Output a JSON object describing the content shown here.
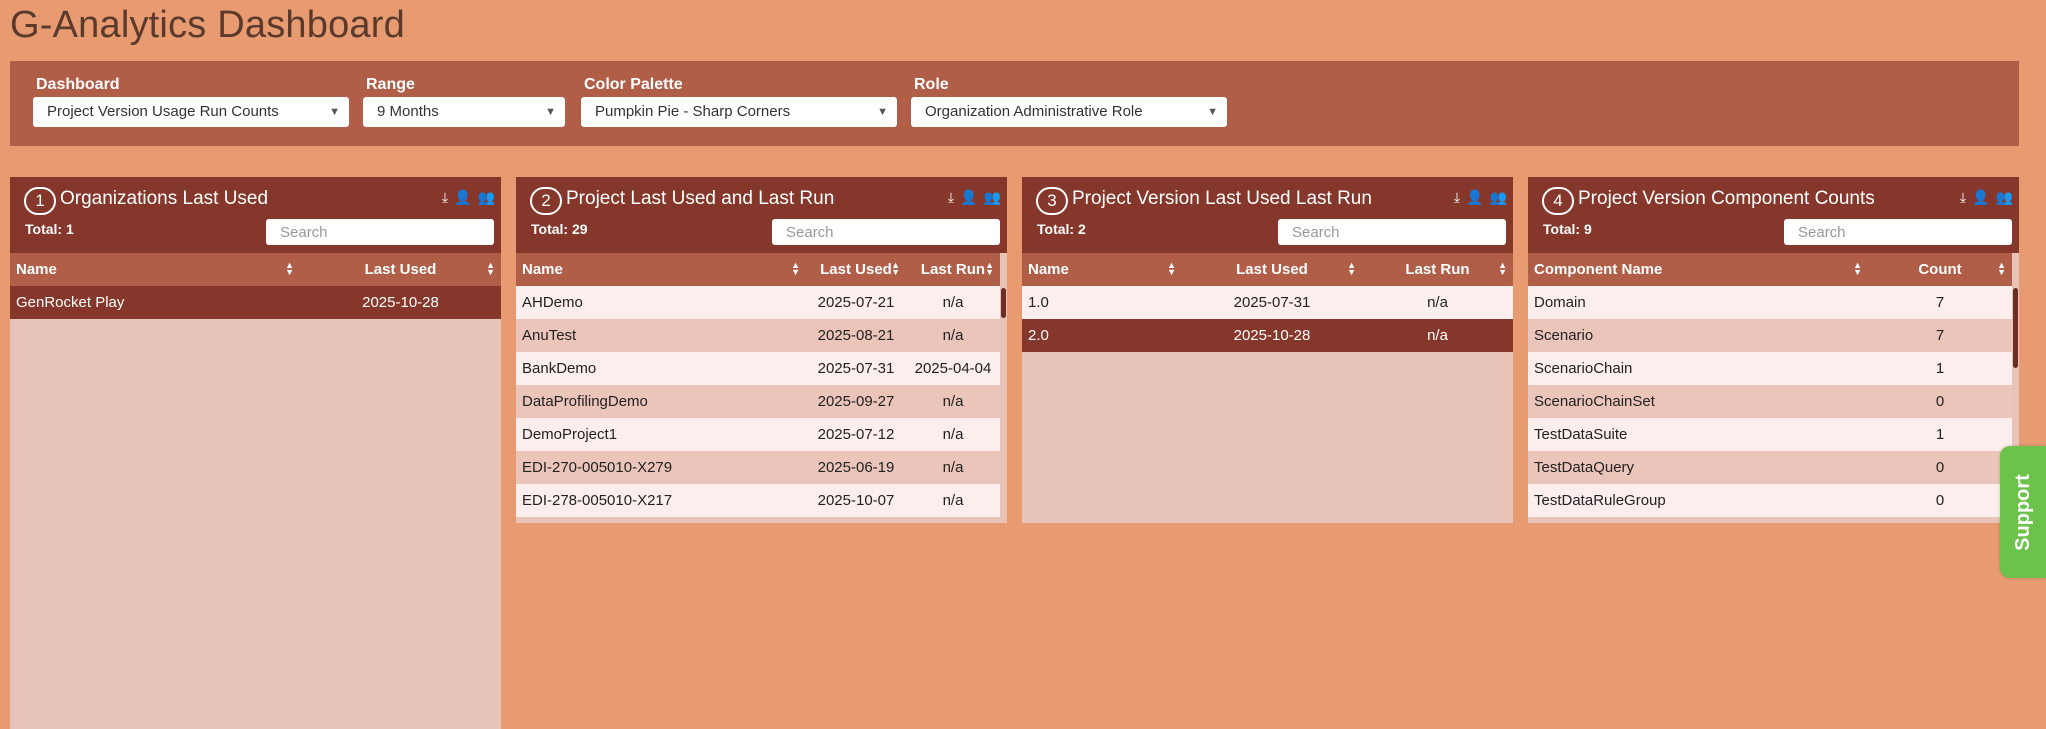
{
  "app": {
    "title": "G-Analytics Dashboard"
  },
  "filters": [
    {
      "label": "Dashboard",
      "value": "Project Version Usage Run Counts"
    },
    {
      "label": "Range",
      "value": "9 Months"
    },
    {
      "label": "Color Palette",
      "value": "Pumpkin Pie - Sharp Corners"
    },
    {
      "label": "Role",
      "value": "Organization Administrative Role"
    }
  ],
  "panels": [
    {
      "number": "1",
      "title": "Organizations Last Used",
      "total": "Total: 1",
      "search_placeholder": "Search",
      "columns": [
        "Name",
        "Last Used"
      ],
      "rows": [
        [
          "GenRocket Play",
          "2025-10-28"
        ]
      ]
    },
    {
      "number": "2",
      "title": "Project Last Used and Last Run",
      "total": "Total: 29",
      "search_placeholder": "Search",
      "columns": [
        "Name",
        "Last Used",
        "Last Run"
      ],
      "rows": [
        [
          "AHDemo",
          "2025-07-21",
          "n/a"
        ],
        [
          "AnuTest",
          "2025-08-21",
          "n/a"
        ],
        [
          "BankDemo",
          "2025-07-31",
          "2025-04-04"
        ],
        [
          "DataProfilingDemo",
          "2025-09-27",
          "n/a"
        ],
        [
          "DemoProject1",
          "2025-07-12",
          "n/a"
        ],
        [
          "EDI-270-005010-X279",
          "2025-06-19",
          "n/a"
        ],
        [
          "EDI-278-005010-X217",
          "2025-10-07",
          "n/a"
        ]
      ]
    },
    {
      "number": "3",
      "title": "Project Version Last Used Last Run",
      "total": "Total: 2",
      "search_placeholder": "Search",
      "columns": [
        "Name",
        "Last Used",
        "Last Run"
      ],
      "rows": [
        [
          "1.0",
          "2025-07-31",
          "n/a"
        ],
        [
          "2.0",
          "2025-10-28",
          "n/a"
        ]
      ]
    },
    {
      "number": "4",
      "title": "Project Version Component Counts",
      "total": "Total: 9",
      "search_placeholder": "Search",
      "columns": [
        "Component Name",
        "Count"
      ],
      "rows": [
        [
          "Domain",
          "7"
        ],
        [
          "Scenario",
          "7"
        ],
        [
          "ScenarioChain",
          "1"
        ],
        [
          "ScenarioChainSet",
          "0"
        ],
        [
          "TestDataSuite",
          "1"
        ],
        [
          "TestDataQuery",
          "0"
        ],
        [
          "TestDataRuleGroup",
          "0"
        ]
      ]
    }
  ],
  "support": {
    "label": "Support"
  },
  "icons": {
    "download": "download-icon",
    "user": "user-icon",
    "users": "users-icon",
    "sort": "sort-icon",
    "dropdown": "chevron-down-icon"
  },
  "colors": {
    "background": "#e89a70",
    "panel_header": "#86372b",
    "filter_bar": "#b05e48",
    "row_light": "#fbeeed",
    "row_dark": "#ecc5ba",
    "support": "#6cc24a"
  }
}
